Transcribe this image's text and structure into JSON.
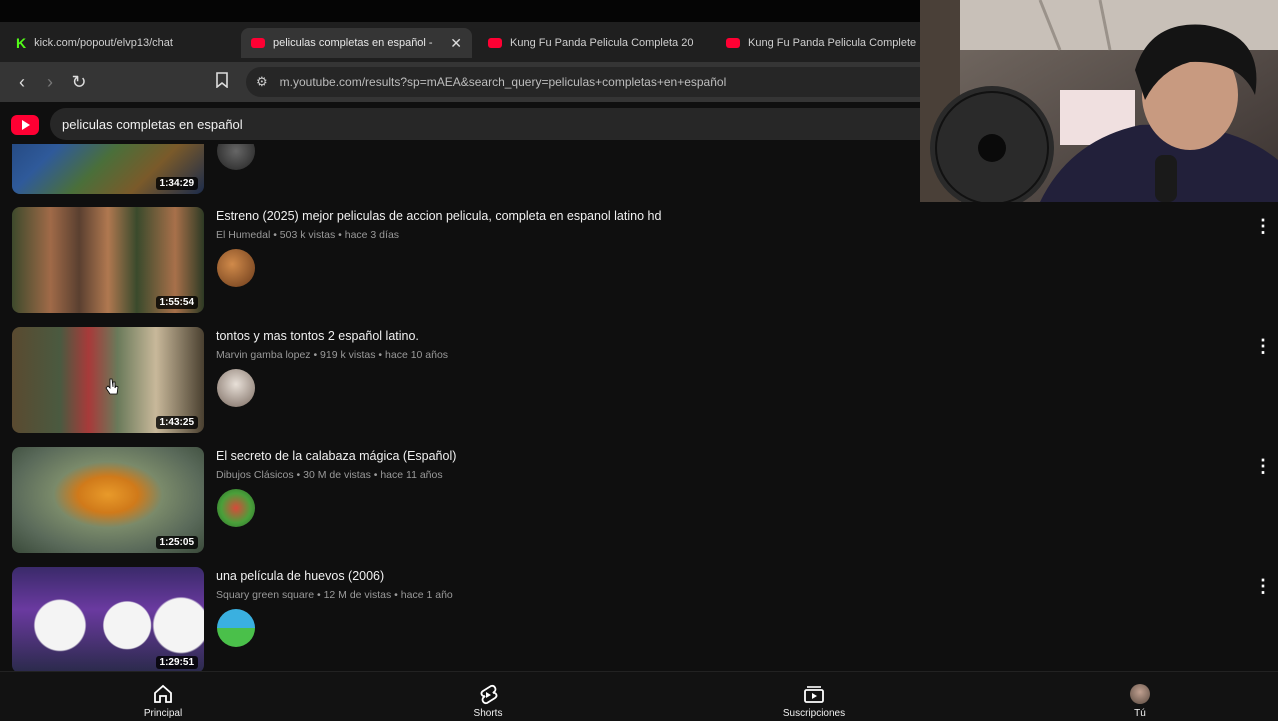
{
  "tabs": [
    {
      "label": "kick.com/popout/elvp13/chat",
      "favicon": "kick-icon",
      "active": false
    },
    {
      "label": "peliculas completas en español -",
      "favicon": "youtube-icon",
      "active": true
    },
    {
      "label": "Kung Fu Panda Pelicula Completa 20",
      "favicon": "youtube-icon",
      "active": false
    },
    {
      "label": "Kung Fu Panda Pelicula Complete",
      "favicon": "youtube-icon",
      "active": false
    }
  ],
  "address_bar": {
    "url": "m.youtube.com/results?sp=mAEA&search_query=peliculas+completas+en+español"
  },
  "search": {
    "query": "peliculas completas en español"
  },
  "videos": [
    {
      "title": "",
      "meta": "",
      "duration": "1:34:29"
    },
    {
      "title": "Estreno (2025) mejor peliculas de accion pelicula, completa en espanol latino hd",
      "meta": "El Humedal • 503 k vistas • hace 3 días",
      "duration": "1:55:54"
    },
    {
      "title": "tontos y mas tontos 2 español latino.",
      "meta": "Marvin gamba lopez • 919 k vistas • hace 10 años",
      "duration": "1:43:25"
    },
    {
      "title": "El secreto de la calabaza mágica (Español)",
      "meta": "Dibujos Clásicos • 30 M de vistas • hace 11 años",
      "duration": "1:25:05"
    },
    {
      "title": "una película de huevos (2006)",
      "meta": "Squary green square • 12 M de vistas • hace 1 año",
      "duration": "1:29:51"
    }
  ],
  "bottom_nav": [
    {
      "label": "Principal",
      "icon": "home-icon"
    },
    {
      "label": "Shorts",
      "icon": "shorts-icon"
    },
    {
      "label": "Suscripciones",
      "icon": "subscriptions-icon"
    },
    {
      "label": "Tú",
      "icon": "avatar"
    }
  ],
  "colors": {
    "accent": "#ff0033",
    "background": "#0f0f0f",
    "kick": "#53fc18"
  }
}
